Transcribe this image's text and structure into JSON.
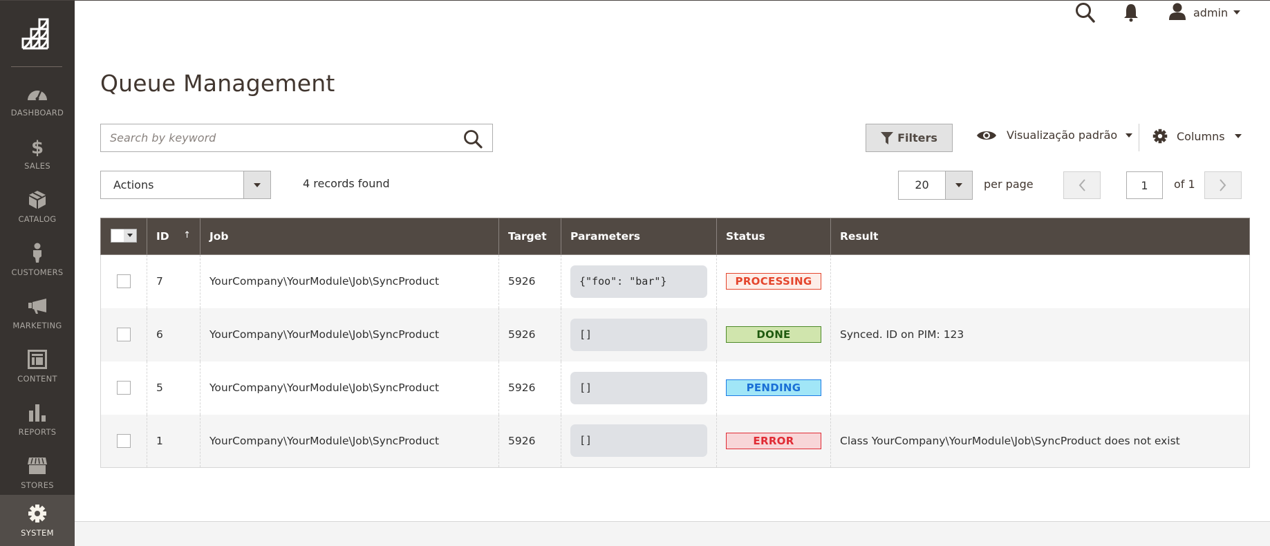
{
  "sidebar": {
    "logo_icon": "magento-logo-icon",
    "items": [
      {
        "label": "DASHBOARD",
        "icon": "speedometer-icon",
        "active": false
      },
      {
        "label": "SALES",
        "icon": "dollar-icon",
        "active": false
      },
      {
        "label": "CATALOG",
        "icon": "box-icon",
        "active": false
      },
      {
        "label": "CUSTOMERS",
        "icon": "person-icon",
        "active": false
      },
      {
        "label": "MARKETING",
        "icon": "megaphone-icon",
        "active": false
      },
      {
        "label": "CONTENT",
        "icon": "layout-icon",
        "active": false
      },
      {
        "label": "REPORTS",
        "icon": "bar-chart-icon",
        "active": false
      },
      {
        "label": "STORES",
        "icon": "storefront-icon",
        "active": false
      },
      {
        "label": "SYSTEM",
        "icon": "gear-icon",
        "active": true
      }
    ]
  },
  "header": {
    "title": "Queue Management",
    "user": "admin",
    "search_icon": "search-icon",
    "notifications_icon": "bell-icon",
    "user_icon": "user-icon"
  },
  "toolbar": {
    "search": {
      "placeholder": "Search by keyword",
      "value": ""
    },
    "filters_label": "Filters",
    "view_label": "Visualização padrão",
    "columns_label": "Columns",
    "actions_label": "Actions",
    "records_found": "4 records found",
    "per_page_value": "20",
    "per_page_label": "per page",
    "current_page": "1",
    "page_of": "of 1"
  },
  "grid": {
    "columns": [
      "ID",
      "Job",
      "Target",
      "Parameters",
      "Status",
      "Result"
    ],
    "sort_indicator": "↑",
    "rows": [
      {
        "id": "7",
        "job": "YourCompany\\YourModule\\Job\\SyncProduct",
        "target": "5926",
        "parameters": "{\"foo\": \"bar\"}",
        "status": "PROCESSING",
        "result": ""
      },
      {
        "id": "6",
        "job": "YourCompany\\YourModule\\Job\\SyncProduct",
        "target": "5926",
        "parameters": "[]",
        "status": "DONE",
        "result": "Synced. ID on PIM: 123"
      },
      {
        "id": "5",
        "job": "YourCompany\\YourModule\\Job\\SyncProduct",
        "target": "5926",
        "parameters": "[]",
        "status": "PENDING",
        "result": ""
      },
      {
        "id": "1",
        "job": "YourCompany\\YourModule\\Job\\SyncProduct",
        "target": "5926",
        "parameters": "[]",
        "status": "ERROR",
        "result": "Class YourCompany\\YourModule\\Job\\SyncProduct does not exist"
      }
    ]
  },
  "status_colors": {
    "PROCESSING": {
      "text": "#e4452c",
      "bg": "#fdeee9",
      "border": "#e4452c"
    },
    "DONE": {
      "text": "#1f5a0f",
      "bg": "#d0e5ad",
      "border": "#4e8a2a"
    },
    "PENDING": {
      "text": "#1a6fd6",
      "bg": "#a1e6f7",
      "border": "#1c7be5"
    },
    "ERROR": {
      "text": "#e02b34",
      "bg": "#f8d6d8",
      "border": "#e02b34"
    }
  }
}
